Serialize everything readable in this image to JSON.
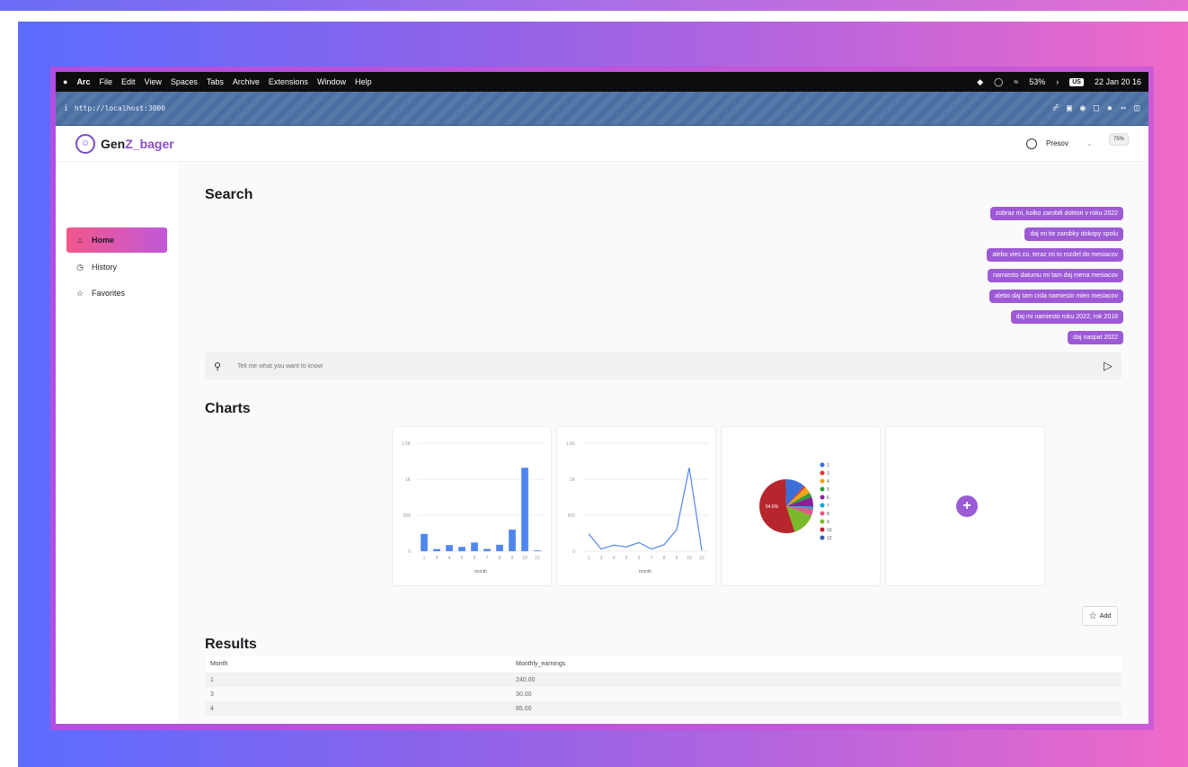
{
  "menubar": {
    "apple": "",
    "app": "Arc",
    "items": [
      "File",
      "Edit",
      "View",
      "Spaces",
      "Tabs",
      "Archive",
      "Extensions",
      "Window",
      "Help"
    ],
    "battery": "53%",
    "lang": "US",
    "datetime": "22 Jan 20 16"
  },
  "browser": {
    "url": "http://localhost:3000"
  },
  "header": {
    "brand_a": "Gen",
    "brand_b": "Z_bager",
    "user": "Presov",
    "zoom": "75%"
  },
  "sidebar": {
    "items": [
      {
        "label": "Home",
        "icon": "home-icon"
      },
      {
        "label": "History",
        "icon": "history-icon"
      },
      {
        "label": "Favorites",
        "icon": "star-icon"
      }
    ]
  },
  "search": {
    "title": "Search",
    "chips": [
      "zobraz mi, kolko zarobili doktori v roku 2022",
      "daj mi tie zarobky dokopy spolu",
      "alebo vies co, teraz mi to rozdel do mesiacov",
      "namiesto datumu mi tam daj mena mesiacov",
      "alebo daj tam cisla namiesto mien mesiacov",
      "daj mi namiesto roku 2022, rok 2018",
      "daj naspat 2022"
    ],
    "placeholder": "Tell me what you want to know"
  },
  "charts": {
    "title": "Charts",
    "add_label": "Add"
  },
  "chart_data": [
    {
      "type": "bar",
      "categories": [
        "1",
        "3",
        "4",
        "5",
        "6",
        "7",
        "8",
        "9",
        "10",
        "12"
      ],
      "values": [
        240,
        30,
        85,
        60,
        120,
        30,
        90,
        300,
        1160,
        10
      ],
      "xlabel": "month",
      "ylim": [
        0,
        1500
      ],
      "yticks": [
        "0",
        "500",
        "1K",
        "1.5K"
      ],
      "color": "#4f86ee"
    },
    {
      "type": "line",
      "categories": [
        "1",
        "3",
        "4",
        "5",
        "6",
        "7",
        "8",
        "9",
        "10",
        "12"
      ],
      "values": [
        240,
        30,
        85,
        60,
        120,
        30,
        90,
        300,
        1160,
        10
      ],
      "xlabel": "month",
      "ylim": [
        0,
        1500
      ],
      "yticks": [
        "0",
        "500",
        "1K",
        "1.5K"
      ],
      "color": "#4f86ee"
    },
    {
      "type": "pie",
      "categories": [
        "1",
        "3",
        "4",
        "5",
        "6",
        "7",
        "8",
        "9",
        "10",
        "12"
      ],
      "values": [
        240,
        30,
        85,
        60,
        120,
        30,
        90,
        300,
        1160,
        10
      ],
      "colors": [
        "#3a6fd8",
        "#d63b2f",
        "#f3a21b",
        "#2e9b3b",
        "#8a1f9a",
        "#1aa5c9",
        "#e05a8a",
        "#79b92b",
        "#b8262d",
        "#2e5aa8"
      ],
      "big_label": "54.6%"
    }
  ],
  "results": {
    "title": "Results",
    "columns": [
      "Month",
      "Monthly_earnings"
    ],
    "rows": [
      [
        "1",
        "240.00"
      ],
      [
        "3",
        "30.00"
      ],
      [
        "4",
        "85.00"
      ]
    ]
  }
}
